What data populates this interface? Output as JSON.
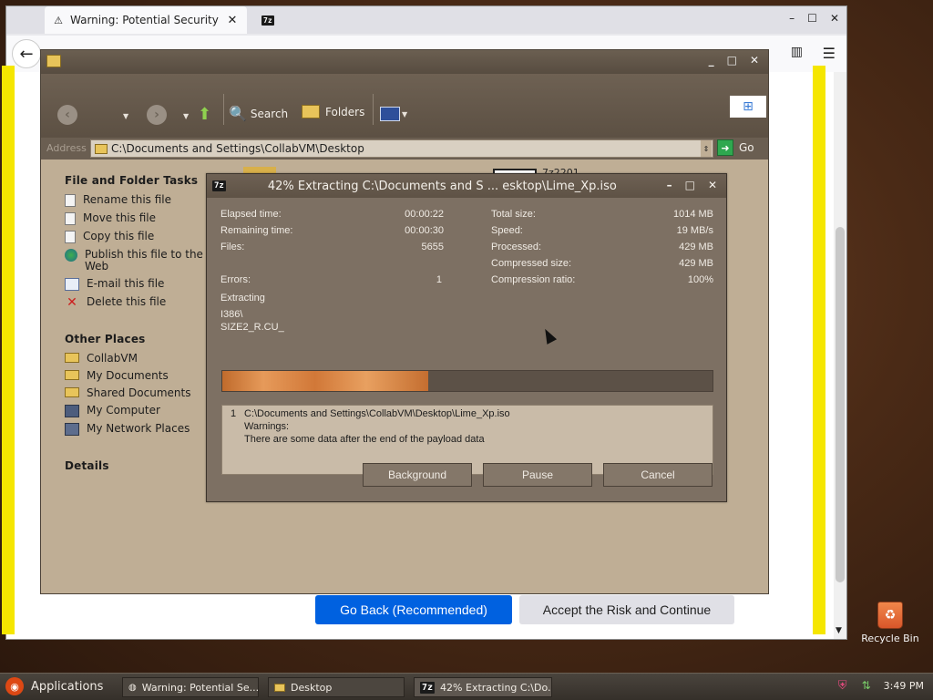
{
  "firefox": {
    "active_tab": "Warning: Potential Security",
    "other_tab_badge": "7z",
    "back_label": "Go Back (Recommended)",
    "accept_label": "Accept the Risk and Continue",
    "icons": {
      "warning": "warning-icon",
      "back": "back-arrow-icon",
      "menu": "hamburger-menu-icon"
    }
  },
  "explorer": {
    "toolbar": {
      "search_label": "Search",
      "folders_label": "Folders"
    },
    "address_label": "Address",
    "address_path": "C:\\Documents and Settings\\CollabVM\\Desktop",
    "go_label": "Go",
    "file_label": "7z2201",
    "file_tasks": {
      "heading": "File and Folder Tasks",
      "items": [
        {
          "label": "Rename this file",
          "icon": "rename-icon"
        },
        {
          "label": "Move this file",
          "icon": "move-icon"
        },
        {
          "label": "Copy this file",
          "icon": "copy-icon"
        },
        {
          "label": "Publish this file to the Web",
          "icon": "publish-icon"
        },
        {
          "label": "E-mail this file",
          "icon": "email-icon"
        },
        {
          "label": "Delete this file",
          "icon": "delete-icon"
        }
      ]
    },
    "other_places": {
      "heading": "Other Places",
      "items": [
        {
          "label": "CollabVM",
          "icon": "folder-icon"
        },
        {
          "label": "My Documents",
          "icon": "documents-folder-icon"
        },
        {
          "label": "Shared Documents",
          "icon": "shared-folder-icon"
        },
        {
          "label": "My Computer",
          "icon": "computer-icon"
        },
        {
          "label": "My Network Places",
          "icon": "network-icon"
        }
      ]
    },
    "details_heading": "Details"
  },
  "dialog": {
    "badge": "7z",
    "title": "42% Extracting C:\\Documents and S ... esktop\\Lime_Xp.iso",
    "progress_fraction": 0.42,
    "left_stats": [
      {
        "label": "Elapsed time:",
        "value": "00:00:22"
      },
      {
        "label": "Remaining time:",
        "value": "00:00:30"
      },
      {
        "label": "Files:",
        "value": "5655"
      },
      {
        "label": "Errors:",
        "value": "1"
      }
    ],
    "right_stats": [
      {
        "label": "Total size:",
        "value": "1014 MB"
      },
      {
        "label": "Speed:",
        "value": "19 MB/s"
      },
      {
        "label": "Processed:",
        "value": "429 MB"
      },
      {
        "label": "Compressed size:",
        "value": "429 MB"
      },
      {
        "label": "Compression ratio:",
        "value": "100%"
      }
    ],
    "extracting_label": "Extracting",
    "current_dir": "I386\\",
    "current_file": "SIZE2_R.CU_",
    "log": {
      "num": "1",
      "path": "C:\\Documents and Settings\\CollabVM\\Desktop\\Lime_Xp.iso",
      "warnings": "Warnings:",
      "message": "There are some data after the end of the payload data"
    },
    "buttons": {
      "background": "Background",
      "pause": "Pause",
      "cancel": "Cancel"
    }
  },
  "desktop": {
    "recycle_bin": "Recycle Bin"
  },
  "taskbar": {
    "applications": "Applications",
    "tasks": [
      {
        "label": "Warning: Potential Se...",
        "icon": "firefox-icon"
      },
      {
        "label": "Desktop",
        "icon": "folder-icon"
      },
      {
        "label": "42% Extracting C:\\Do...",
        "icon": "7zip-icon"
      }
    ],
    "clock": "3:49 PM"
  },
  "colors": {
    "firefox_primary": "#0061e0",
    "warning_yellow": "#f5e600",
    "progress_orange": "#d17838"
  }
}
